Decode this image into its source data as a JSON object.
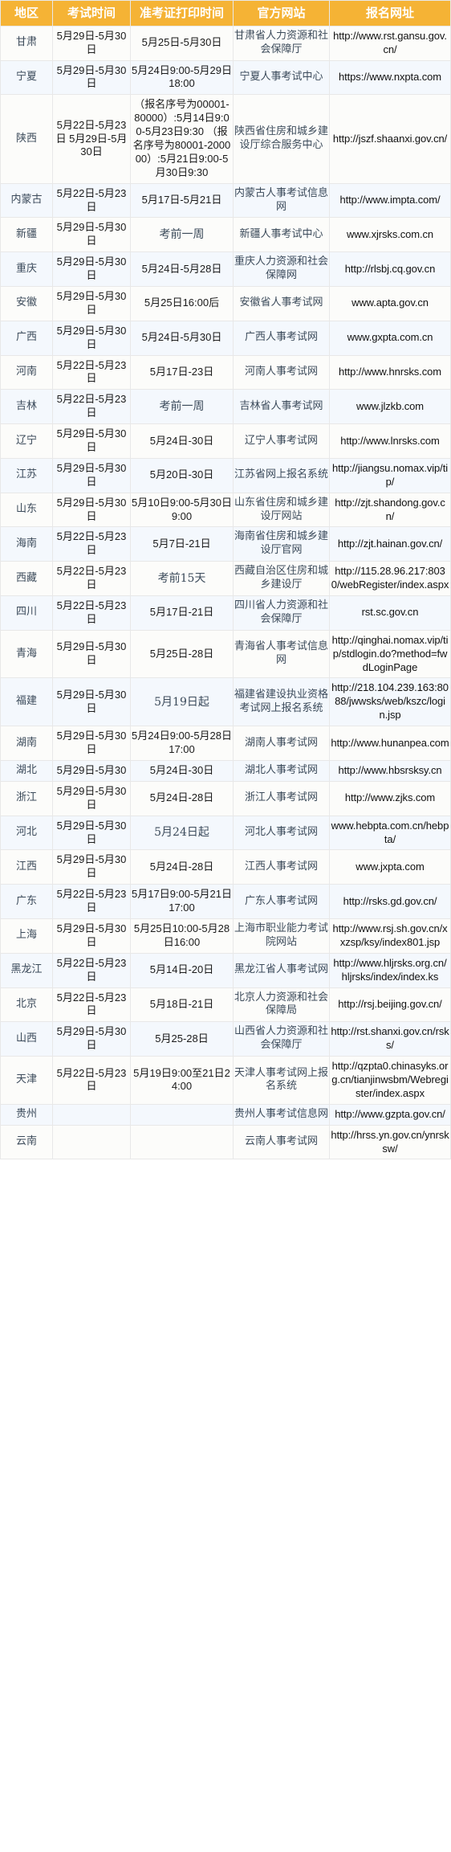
{
  "table": {
    "columns": [
      {
        "key": "region",
        "label": "地区"
      },
      {
        "key": "exam_time",
        "label": "考试时间"
      },
      {
        "key": "admit_print_time",
        "label": "准考证打印时间"
      },
      {
        "key": "official_site",
        "label": "官方网站"
      },
      {
        "key": "register_url",
        "label": "报名网址"
      }
    ],
    "colors": {
      "header_bg": "#f5b335",
      "header_text": "#ffffff",
      "row_even_bg": "#fcfcfa",
      "row_odd_bg": "#f4f8fd",
      "grid_line": "#e8e8e8",
      "region_text": "#3b4a5a",
      "value_text": "#1a1a1a"
    },
    "rows": [
      {
        "region": "甘肃",
        "exam_time": "5月29日-5月30日",
        "admit_print_time": "5月25日-5月30日",
        "official_site": "甘肃省人力资源和社会保障厅",
        "register_url": "http://www.rst.gansu.gov.cn/"
      },
      {
        "region": "宁夏",
        "exam_time": "5月29日-5月30日",
        "admit_print_time": "5月24日9:00-5月29日18:00",
        "official_site": "宁夏人事考试中心",
        "register_url": "https://www.nxpta.com"
      },
      {
        "region": "陕西",
        "exam_time": "5月22日-5月23日 5月29日-5月30日",
        "admit_print_time": "（报名序号为00001-80000）:5月14日9:00-5月23日9:30 （报名序号为80001-200000）:5月21日9:00-5月30日9:30",
        "official_site": "陕西省住房和城乡建设厅综合服务中心",
        "register_url": "http://jszf.shaanxi.gov.cn/"
      },
      {
        "region": "内蒙古",
        "exam_time": "5月22日-5月23日",
        "admit_print_time": "5月17日-5月21日",
        "official_site": "内蒙古人事考试信息网",
        "register_url": "http://www.impta.com/"
      },
      {
        "region": "新疆",
        "exam_time": "5月29日-5月30日",
        "admit_print_time": "考前一周",
        "official_site": "新疆人事考试中心",
        "register_url": "www.xjrsks.com.cn"
      },
      {
        "region": "重庆",
        "exam_time": "5月29日-5月30日",
        "admit_print_time": "5月24日-5月28日",
        "official_site": "重庆人力资源和社会保障网",
        "register_url": "http://rlsbj.cq.gov.cn"
      },
      {
        "region": "安徽",
        "exam_time": "5月29日-5月30日",
        "admit_print_time": "5月25日16:00后",
        "official_site": "安徽省人事考试网",
        "register_url": "www.apta.gov.cn"
      },
      {
        "region": "广西",
        "exam_time": "5月29日-5月30日",
        "admit_print_time": "5月24日-5月30日",
        "official_site": "广西人事考试网",
        "register_url": "www.gxpta.com.cn"
      },
      {
        "region": "河南",
        "exam_time": "5月22日-5月23日",
        "admit_print_time": "5月17日-23日",
        "official_site": "河南人事考试网",
        "register_url": "http://www.hnrsks.com"
      },
      {
        "region": "吉林",
        "exam_time": "5月22日-5月23日",
        "admit_print_time": "考前一周",
        "official_site": "吉林省人事考试网",
        "register_url": "www.jlzkb.com"
      },
      {
        "region": "辽宁",
        "exam_time": "5月29日-5月30日",
        "admit_print_time": "5月24日-30日",
        "official_site": "辽宁人事考试网",
        "register_url": "http://www.lnrsks.com"
      },
      {
        "region": "江苏",
        "exam_time": "5月29日-5月30日",
        "admit_print_time": "5月20日-30日",
        "official_site": "江苏省网上报名系统",
        "register_url": "http://jiangsu.nomax.vip/tip/"
      },
      {
        "region": "山东",
        "exam_time": "5月29日-5月30日",
        "admit_print_time": "5月10日9:00-5月30日9:00",
        "official_site": "山东省住房和城乡建设厅网站",
        "register_url": "http://zjt.shandong.gov.cn/"
      },
      {
        "region": "海南",
        "exam_time": "5月22日-5月23日",
        "admit_print_time": "5月7日-21日",
        "official_site": "海南省住房和城乡建设厅官网",
        "register_url": "http://zjt.hainan.gov.cn/"
      },
      {
        "region": "西藏",
        "exam_time": "5月22日-5月23日",
        "admit_print_time": "考前15天",
        "official_site": "西藏自治区住房和城乡建设厅",
        "register_url": "http://115.28.96.217:8030/webRegister/index.aspx"
      },
      {
        "region": "四川",
        "exam_time": "5月22日-5月23日",
        "admit_print_time": "5月17日-21日",
        "official_site": "四川省人力资源和社会保障厅",
        "register_url": "rst.sc.gov.cn"
      },
      {
        "region": "青海",
        "exam_time": "5月29日-5月30日",
        "admit_print_time": "5月25日-28日",
        "official_site": "青海省人事考试信息网",
        "register_url": "http://qinghai.nomax.vip/tip/stdlogin.do?method=fwdLoginPage"
      },
      {
        "region": "福建",
        "exam_time": "5月29日-5月30日",
        "admit_print_time": "5月19日起",
        "official_site": "福建省建设执业资格考试网上报名系统",
        "register_url": "http://218.104.239.163:8088/jwwsks/web/kszc/login.jsp"
      },
      {
        "region": "湖南",
        "exam_time": "5月29日-5月30日",
        "admit_print_time": "5月24日9:00-5月28日17:00",
        "official_site": "湖南人事考试网",
        "register_url": "http://www.hunanpea.com"
      },
      {
        "region": "湖北",
        "exam_time": "5月29日-5月30",
        "admit_print_time": "5月24日-30日",
        "official_site": "湖北人事考试网",
        "register_url": "http://www.hbsrsksy.cn"
      },
      {
        "region": "浙江",
        "exam_time": "5月29日-5月30日",
        "admit_print_time": "5月24日-28日",
        "official_site": "浙江人事考试网",
        "register_url": "http://www.zjks.com"
      },
      {
        "region": "河北",
        "exam_time": "5月29日-5月30日",
        "admit_print_time": "5月24日起",
        "official_site": "河北人事考试网",
        "register_url": "www.hebpta.com.cn/hebpta/"
      },
      {
        "region": "江西",
        "exam_time": "5月29日-5月30日",
        "admit_print_time": "5月24日-28日",
        "official_site": "江西人事考试网",
        "register_url": "www.jxpta.com"
      },
      {
        "region": "广东",
        "exam_time": "5月22日-5月23日",
        "admit_print_time": "5月17日9:00-5月21日17:00",
        "official_site": "广东人事考试网",
        "register_url": "http://rsks.gd.gov.cn/"
      },
      {
        "region": "上海",
        "exam_time": "5月29日-5月30日",
        "admit_print_time": "5月25日10:00-5月28日16:00",
        "official_site": "上海市职业能力考试院网站",
        "register_url": "http://www.rsj.sh.gov.cn/xxzsp/ksy/index801.jsp"
      },
      {
        "region": "黑龙江",
        "exam_time": "5月22日-5月23日",
        "admit_print_time": "5月14日-20日",
        "official_site": "黑龙江省人事考试网",
        "register_url": "http://www.hljrsks.org.cn/hljrsks/index/index.ks"
      },
      {
        "region": "北京",
        "exam_time": "5月22日-5月23日",
        "admit_print_time": "5月18日-21日",
        "official_site": "北京人力资源和社会保障局",
        "register_url": "http://rsj.beijing.gov.cn/"
      },
      {
        "region": "山西",
        "exam_time": "5月29日-5月30日",
        "admit_print_time": "5月25-28日",
        "official_site": "山西省人力资源和社会保障厅",
        "register_url": "http://rst.shanxi.gov.cn/rsks/"
      },
      {
        "region": "天津",
        "exam_time": "5月22日-5月23日",
        "admit_print_time": "5月19日9:00至21日24:00",
        "official_site": "天津人事考试网上报名系统",
        "register_url": "http://qzpta0.chinasyks.org.cn/tianjinwsbm/Webregister/index.aspx"
      },
      {
        "region": "贵州",
        "exam_time": "",
        "admit_print_time": "",
        "official_site": "贵州人事考试信息网",
        "register_url": "http://www.gzpta.gov.cn/"
      },
      {
        "region": "云南",
        "exam_time": "",
        "admit_print_time": "",
        "official_site": "云南人事考试网",
        "register_url": "http://hrss.yn.gov.cn/ynrsksw/"
      }
    ]
  }
}
